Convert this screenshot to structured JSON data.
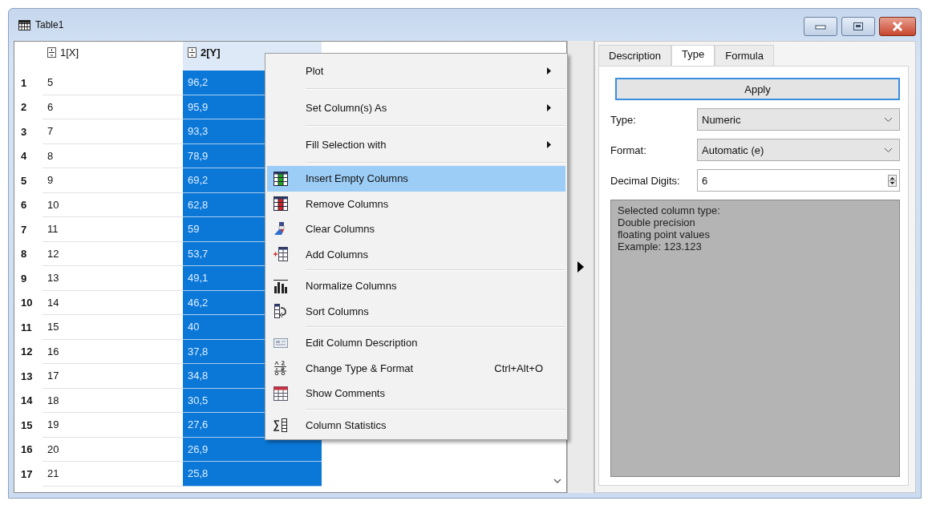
{
  "window": {
    "title": "Table1"
  },
  "table": {
    "columns": [
      {
        "label": "1[X]",
        "selected": false
      },
      {
        "label": "2[Y]",
        "selected": true
      }
    ],
    "rows": [
      {
        "number": "1",
        "cells": [
          "5",
          "96,2"
        ]
      },
      {
        "number": "2",
        "cells": [
          "6",
          "95,9"
        ]
      },
      {
        "number": "3",
        "cells": [
          "7",
          "93,3"
        ]
      },
      {
        "number": "4",
        "cells": [
          "8",
          "78,9"
        ]
      },
      {
        "number": "5",
        "cells": [
          "9",
          "69,2"
        ]
      },
      {
        "number": "6",
        "cells": [
          "10",
          "62,8"
        ]
      },
      {
        "number": "7",
        "cells": [
          "11",
          "59"
        ]
      },
      {
        "number": "8",
        "cells": [
          "12",
          "53,7"
        ]
      },
      {
        "number": "9",
        "cells": [
          "13",
          "49,1"
        ]
      },
      {
        "number": "10",
        "cells": [
          "14",
          "46,2"
        ]
      },
      {
        "number": "11",
        "cells": [
          "15",
          "40"
        ]
      },
      {
        "number": "12",
        "cells": [
          "16",
          "37,8"
        ]
      },
      {
        "number": "13",
        "cells": [
          "17",
          "34,8"
        ]
      },
      {
        "number": "14",
        "cells": [
          "18",
          "30,5"
        ]
      },
      {
        "number": "15",
        "cells": [
          "19",
          "27,6"
        ]
      },
      {
        "number": "16",
        "cells": [
          "20",
          "26,9"
        ]
      },
      {
        "number": "17",
        "cells": [
          "21",
          "25,8"
        ]
      }
    ]
  },
  "context_menu": {
    "items": [
      {
        "kind": "submenu",
        "label": "Plot",
        "selected": false
      },
      {
        "kind": "separator"
      },
      {
        "kind": "submenu",
        "label": "Set Column(s) As",
        "selected": false
      },
      {
        "kind": "separator"
      },
      {
        "kind": "submenu",
        "label": "Fill Selection with",
        "selected": false
      },
      {
        "kind": "separator"
      },
      {
        "kind": "action",
        "label": "Insert Empty Columns",
        "selected": true
      },
      {
        "kind": "action",
        "label": "Remove Columns",
        "selected": false
      },
      {
        "kind": "action",
        "label": "Clear Columns",
        "selected": false
      },
      {
        "kind": "action",
        "label": "Add Columns",
        "selected": false
      },
      {
        "kind": "separator"
      },
      {
        "kind": "action",
        "label": "Normalize Columns",
        "selected": false
      },
      {
        "kind": "action",
        "label": "Sort Columns",
        "selected": false
      },
      {
        "kind": "separator"
      },
      {
        "kind": "action",
        "label": "Edit Column Description",
        "selected": false
      },
      {
        "kind": "action",
        "label": "Change Type & Format",
        "shortcut": "Ctrl+Alt+O",
        "selected": false
      },
      {
        "kind": "action",
        "label": "Show Comments",
        "selected": false
      },
      {
        "kind": "separator"
      },
      {
        "kind": "action",
        "label": "Column Statistics",
        "selected": false
      }
    ]
  },
  "panel": {
    "tabs": [
      {
        "label": "Description",
        "selected": false
      },
      {
        "label": "Type",
        "selected": true
      },
      {
        "label": "Formula",
        "selected": false
      }
    ],
    "apply_button": "Apply",
    "type": {
      "label": "Type:",
      "value": "Numeric"
    },
    "format": {
      "label": "Format:",
      "value": "Automatic (e)"
    },
    "decimal_digits": {
      "label": "Decimal Digits:",
      "value": "6"
    },
    "info": "Selected column type:\nDouble precision\nfloating point values\nExample: 123.123"
  }
}
